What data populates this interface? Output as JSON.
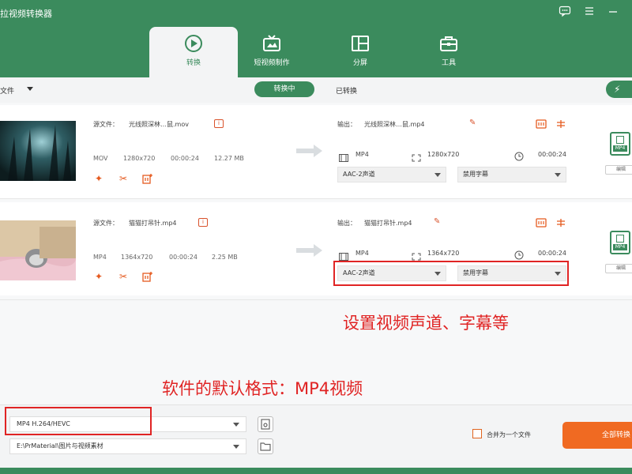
{
  "header": {
    "title": "拉视频转换器",
    "tabs": [
      {
        "label": "转换",
        "icon": "convert-icon",
        "active": true
      },
      {
        "label": "短视频制作",
        "icon": "video-maker-icon",
        "active": false
      },
      {
        "label": "分屏",
        "icon": "split-screen-icon",
        "active": false
      },
      {
        "label": "工具",
        "icon": "toolbox-icon",
        "active": false
      }
    ]
  },
  "toolbar": {
    "file_label": "文件",
    "status_converting": "转换中",
    "status_converted": "已转换",
    "power_icon": "⚡"
  },
  "rows": [
    {
      "source_label": "源文件：",
      "source_name": "光线照深林…鼠.mov",
      "format": "MOV",
      "resolution": "1280x720",
      "duration": "00:00:24",
      "size": "12.27 MB",
      "output_label": "输出：",
      "output_name": "光线照深林…鼠.mp4",
      "out_format": "MP4",
      "out_resolution": "1280x720",
      "out_duration": "00:00:24",
      "audio": "AAC-2声道",
      "subtitle": "禁用字幕",
      "badge_label": "MP4",
      "edit_btn": "编辑"
    },
    {
      "source_label": "源文件：",
      "source_name": "猫猫打吊针.mp4",
      "format": "MP4",
      "resolution": "1364x720",
      "duration": "00:00:24",
      "size": "2.25 MB",
      "output_label": "输出：",
      "output_name": "猫猫打吊针.mp4",
      "out_format": "MP4",
      "out_resolution": "1364x720",
      "out_duration": "00:00:24",
      "audio": "AAC-2声道",
      "subtitle": "禁用字幕",
      "badge_label": "MP4",
      "edit_btn": "编辑"
    }
  ],
  "annotations": {
    "audio_subtitle": "设置视频声道、字幕等",
    "default_format": "软件的默认格式：MP4视频"
  },
  "footer": {
    "format_value": "MP4 H.264/HEVC",
    "path_value": "E:\\PrMaterial\\图片与视频素材",
    "merge_label": "合并为一个文件",
    "convert_all": "全部转换"
  },
  "colors": {
    "brand_green": "#3b8b5d",
    "accent_orange": "#f06a22",
    "annotation_red": "#e02424"
  }
}
